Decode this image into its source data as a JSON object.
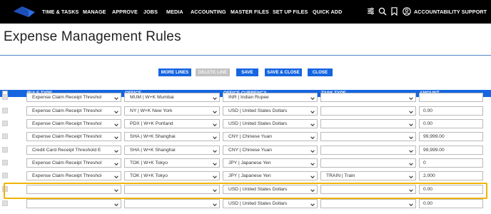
{
  "nav": {
    "items": [
      "TIME & TASKS",
      "MANAGE",
      "APPROVE",
      "JOBS",
      "MEDIA",
      "ACCOUNTING",
      "MASTER FILES",
      "SET UP FILES",
      "QUICK ADD"
    ],
    "user_label": "ACCOUNTABILITY SUPPORT"
  },
  "page": {
    "title": "Expense Management Rules"
  },
  "toolbar": {
    "more_lines": "MORE LINES",
    "delete_line": "DELETE LINE",
    "save": "SAVE",
    "save_close": "SAVE & CLOSE",
    "close": "CLOSE"
  },
  "table": {
    "headers": [
      "RULE TYPE",
      "OFFICE",
      "OFFICE CURRENCY",
      "TASK TYPE",
      "AMOUNT"
    ],
    "rows": [
      {
        "rule_type": "Expense Claim Receipt Threshol",
        "office": "MUM | W+K Mumbai",
        "currency": "INR | Indian Rupee",
        "task_type": "",
        "amount": ""
      },
      {
        "rule_type": "Expense Claim Receipt Threshol",
        "office": "NY | W+K New York",
        "currency": "USD | United States Dollars",
        "task_type": "",
        "amount": "0.00"
      },
      {
        "rule_type": "Expense Claim Receipt Threshol",
        "office": "PDX | W+K Portland",
        "currency": "USD | United States Dollars",
        "task_type": "",
        "amount": "0.00"
      },
      {
        "rule_type": "Expense Claim Receipt Threshol",
        "office": "SHA | W+K Shanghai",
        "currency": "CNY | Chinese Yuan",
        "task_type": "",
        "amount": "99,999.00"
      },
      {
        "rule_type": "Credit Card Receipt Threshold E",
        "office": "SHA | W+K Shanghai",
        "currency": "CNY | Chinese Yuan",
        "task_type": "",
        "amount": "99,999.00"
      },
      {
        "rule_type": "Expense Claim Receipt Threshol",
        "office": "TOK | W+K Tokyo",
        "currency": "JPY | Japanese Yen",
        "task_type": "",
        "amount": "0"
      },
      {
        "rule_type": "Expense Claim Receipt Threshol",
        "office": "TOK | W+K Tokyo",
        "currency": "JPY | Japanese Yen",
        "task_type": "TRAIN | Train",
        "amount": "2,000"
      },
      {
        "rule_type": "",
        "office": "",
        "currency": "USD | United States Dollars",
        "task_type": "",
        "amount": "0.00"
      },
      {
        "rule_type": "",
        "office": "",
        "currency": "USD | United States Dollars",
        "task_type": "",
        "amount": "0.00"
      }
    ]
  },
  "colors": {
    "accent": "#1565e0",
    "highlight": "#f0b400",
    "nav_bg": "#000000"
  },
  "icons": {
    "logo": "diamond-logo-icon",
    "filter": "sliders-icon",
    "search": "search-icon",
    "bookmark": "bookmark-icon",
    "user": "user-circle-icon",
    "dropdown": "chevron-down-icon"
  }
}
